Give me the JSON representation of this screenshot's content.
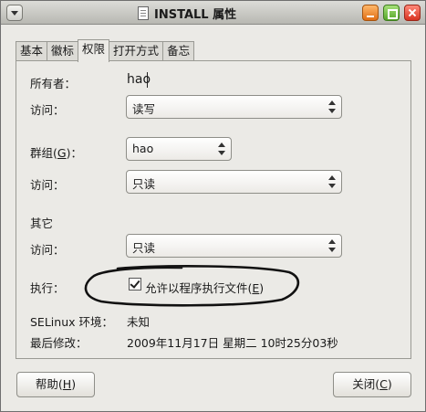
{
  "window": {
    "title": "INSTALL 属性"
  },
  "tabs": [
    {
      "label": "基本",
      "active": false
    },
    {
      "label": "徽标",
      "active": false
    },
    {
      "label": "权限",
      "active": true
    },
    {
      "label": "打开方式",
      "active": false
    },
    {
      "label": "备忘",
      "active": false
    }
  ],
  "permissions": {
    "owner_label": "所有者：",
    "owner_value": "hao",
    "owner_access_label": "访问：",
    "owner_access_value": "读写",
    "group_label_pre": "群组(",
    "group_mnemonic": "G",
    "group_label_post": ")：",
    "group_value": "hao",
    "group_access_label": "访问：",
    "group_access_value": "只读",
    "others_label": "其它",
    "others_access_label": "访问：",
    "others_access_value": "只读",
    "execute_label": "执行：",
    "execute_checkbox_pre": "允许以程序执行文件(",
    "execute_mnemonic": "E",
    "execute_checkbox_post": ")",
    "execute_checked": true,
    "selinux_label": "SELinux 环境：",
    "selinux_value": "未知",
    "modified_label": "最后修改：",
    "modified_value": "2009年11月17日 星期二 10时25分03秒"
  },
  "buttons": {
    "help_pre": "帮助(",
    "help_mnemonic": "H",
    "help_post": ")",
    "close_pre": "关闭(",
    "close_mnemonic": "C",
    "close_post": ")"
  },
  "colors": {
    "window_bg": "#ebeae6",
    "minimize": "#e06e14",
    "maximize": "#55a62a",
    "close": "#d8321f"
  }
}
